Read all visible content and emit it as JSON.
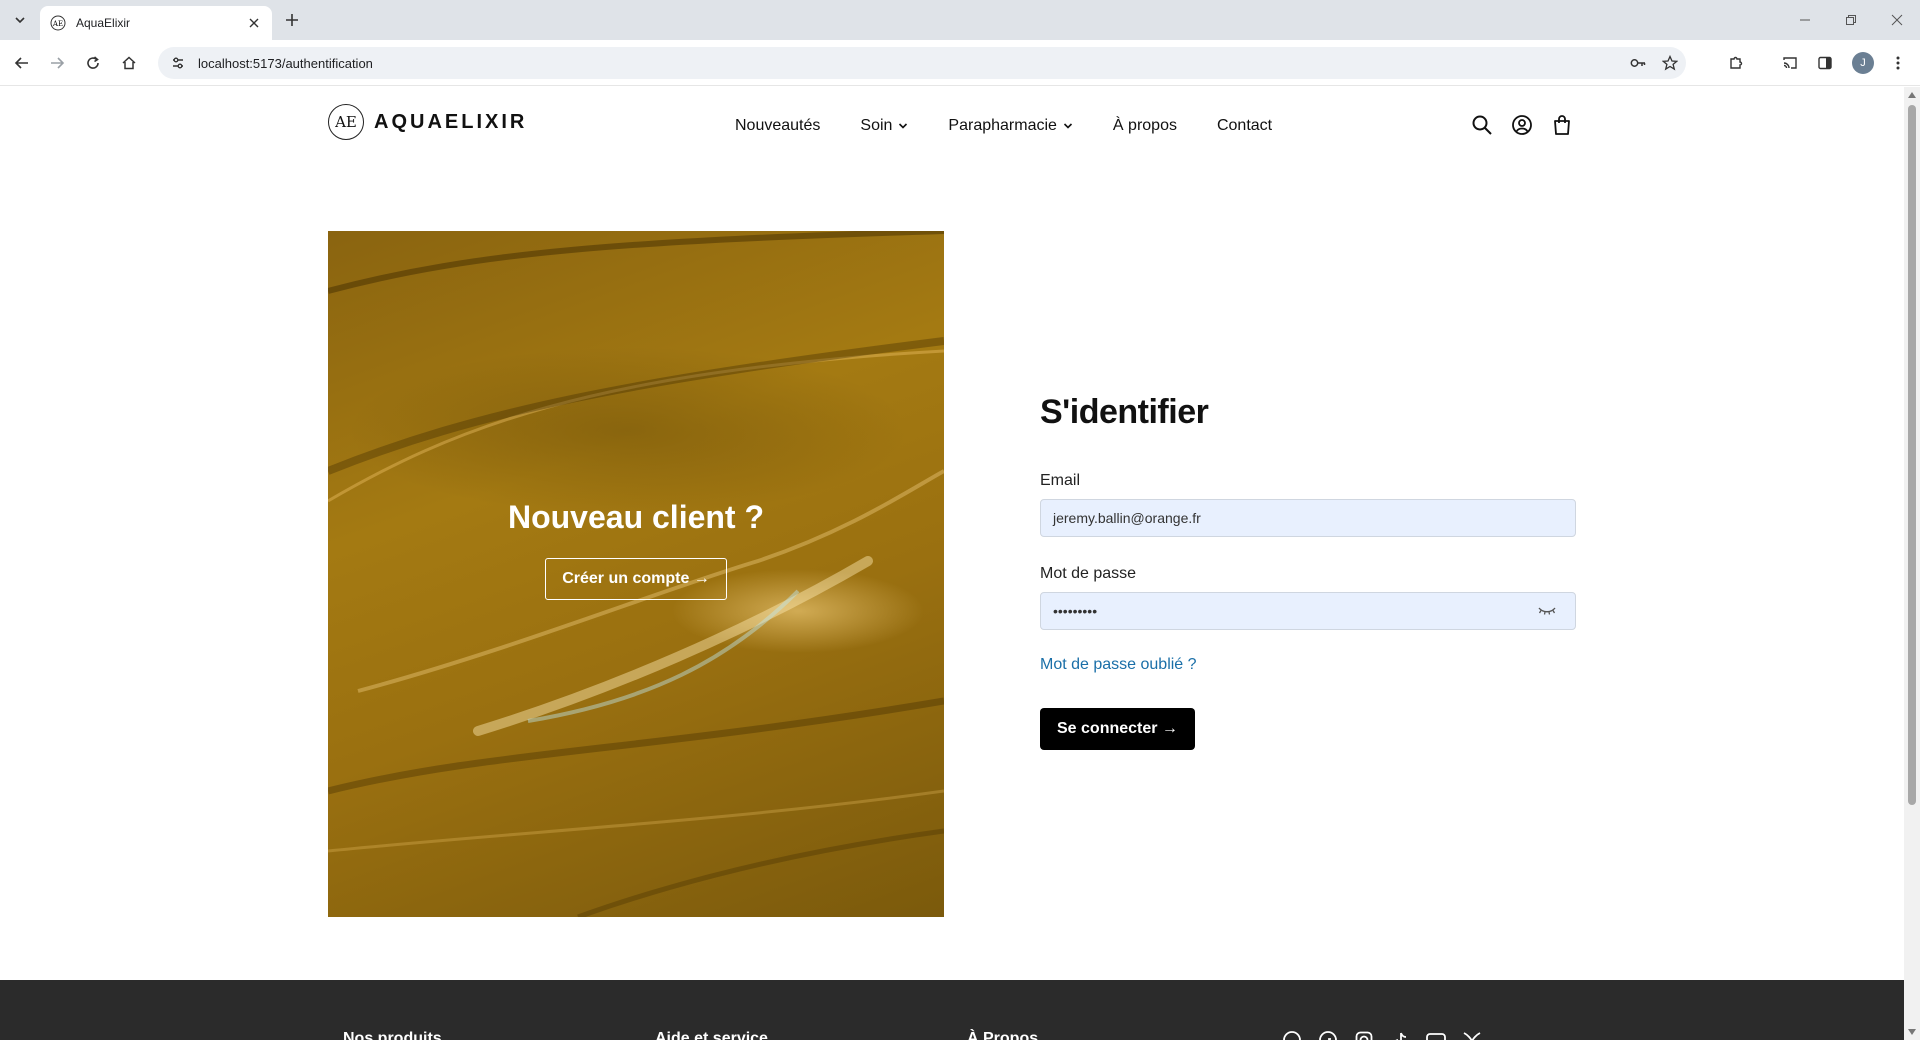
{
  "browser": {
    "tab_title": "AquaElixir",
    "url": "localhost:5173/authentification",
    "profile_initial": "J"
  },
  "header": {
    "logo_mark": "AE",
    "brand": "AQUAELIXIR",
    "nav": [
      {
        "label": "Nouveautés",
        "has_dropdown": false
      },
      {
        "label": "Soin",
        "has_dropdown": true
      },
      {
        "label": "Parapharmacie",
        "has_dropdown": true
      },
      {
        "label": "À propos",
        "has_dropdown": false
      },
      {
        "label": "Contact",
        "has_dropdown": false
      }
    ],
    "icons": [
      "search-icon",
      "account-icon",
      "cart-icon"
    ]
  },
  "hero": {
    "title": "Nouveau client ?",
    "button": "Créer un compte →"
  },
  "login": {
    "title": "S'identifier",
    "email_label": "Email",
    "email_value": "jeremy.ballin@orange.fr",
    "password_label": "Mot de passe",
    "password_value": "•••••••••",
    "forgot": "Mot de passe oublié ?",
    "submit": "Se connecter →"
  },
  "footer": {
    "columns": [
      "Nos produits",
      "Aide et service",
      "À Propos"
    ],
    "social_icons": [
      "threads-icon",
      "facebook-icon",
      "instagram-icon",
      "tiktok-icon",
      "youtube-icon",
      "bluesky-icon"
    ]
  },
  "colors": {
    "accent_link": "#1a6fa8",
    "hero_gold": "#9a7010",
    "footer_bg": "#2b2b2b",
    "autofill_bg": "#e8f0fe"
  }
}
